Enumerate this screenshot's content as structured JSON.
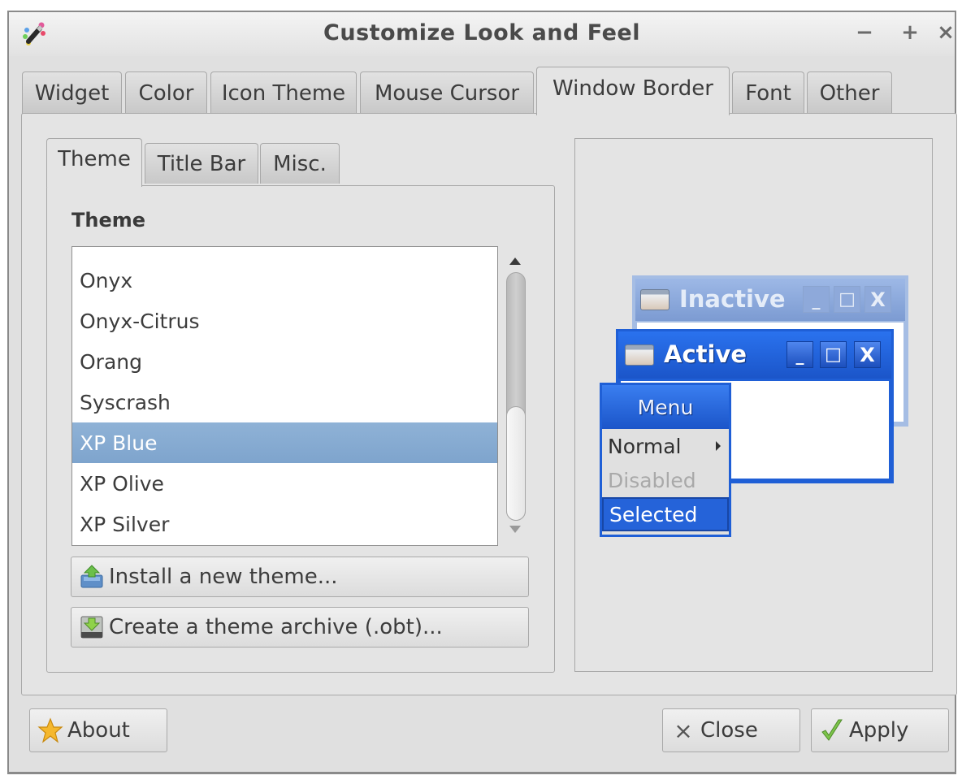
{
  "window": {
    "title": "Customize Look and Feel",
    "controls": {
      "minimize": "−",
      "maximize": "+",
      "close": "×"
    }
  },
  "tabs": [
    {
      "label": "Widget",
      "active": false
    },
    {
      "label": "Color",
      "active": false
    },
    {
      "label": "Icon Theme",
      "active": false
    },
    {
      "label": "Mouse Cursor",
      "active": false
    },
    {
      "label": "Window Border",
      "active": true
    },
    {
      "label": "Font",
      "active": false
    },
    {
      "label": "Other",
      "active": false
    }
  ],
  "sub_tabs": [
    {
      "label": "Theme",
      "active": true
    },
    {
      "label": "Title Bar",
      "active": false
    },
    {
      "label": "Misc.",
      "active": false
    }
  ],
  "theme_section": {
    "label": "Theme",
    "items": [
      "Onyx",
      "Onyx-Citrus",
      "Orang",
      "Syscrash",
      "XP Blue",
      "XP Olive",
      "XP Silver"
    ],
    "selected": "XP Blue",
    "install_button": "Install a new theme...",
    "archive_button": "Create a theme archive (.obt)..."
  },
  "preview": {
    "inactive_title": "Inactive",
    "active_title": "Active",
    "menu_title": "Menu",
    "menu_items": {
      "normal": "Normal",
      "disabled": "Disabled",
      "selected": "Selected"
    },
    "button_glyphs": {
      "iconify": "_",
      "maximize": "□",
      "close": "X"
    },
    "colors": {
      "active": "#1f5fd6",
      "inactive": "#a5bde4",
      "selected": "#2563d9"
    }
  },
  "footer": {
    "about": "About",
    "close": "Close",
    "close_glyph": "×",
    "apply": "Apply"
  },
  "icons": {
    "app": "paintbrush-icon",
    "install": "install-theme-icon",
    "archive": "archive-icon",
    "about": "star-icon",
    "close": "close-icon",
    "apply": "checkmark-icon"
  }
}
